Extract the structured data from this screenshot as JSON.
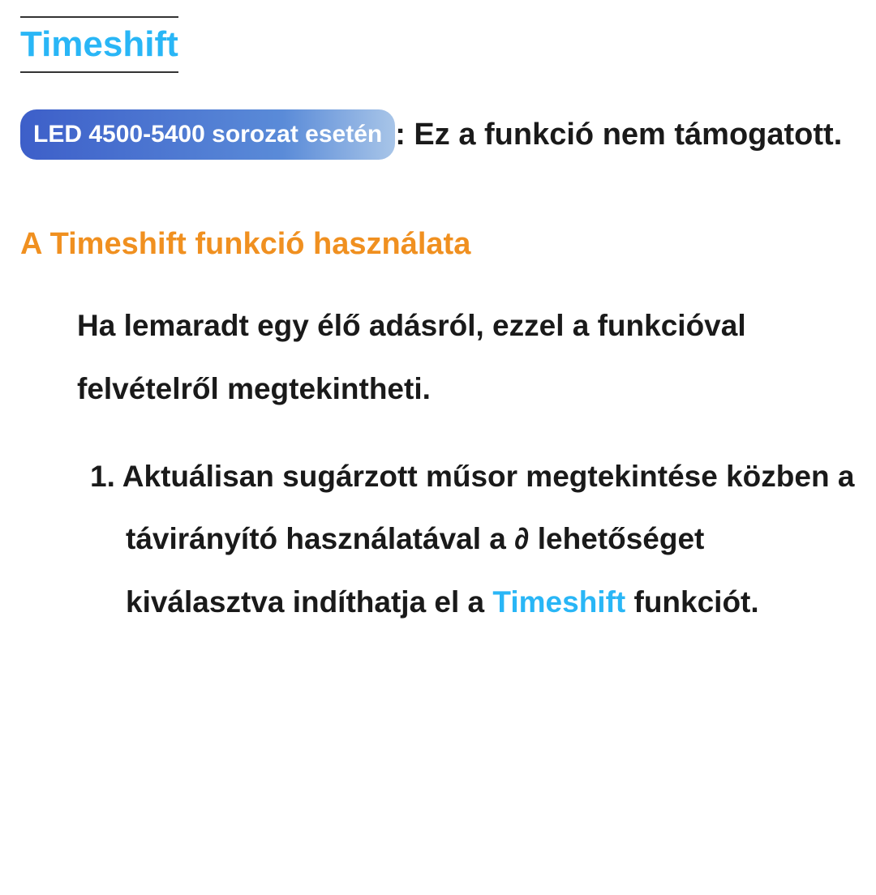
{
  "title": "Timeshift",
  "note": {
    "badge": "LED 4500-5400 sorozat esetén",
    "text_after": ": Ez a funkció nem támogatott."
  },
  "section_heading": "A Timeshift funkció használata",
  "intro_paragraph": "Ha lemaradt egy élő adásról, ezzel a funkcióval felvételről megtekintheti.",
  "list": {
    "item1": {
      "number": "1.",
      "part1": "Aktuálisan sugárzott műsor megtekintése közben a távirányító használatával a ",
      "play_symbol": "∂",
      "part2": " lehetőséget kiválasztva indíthatja el a ",
      "highlight": "Timeshift",
      "part3": " funkciót."
    }
  }
}
